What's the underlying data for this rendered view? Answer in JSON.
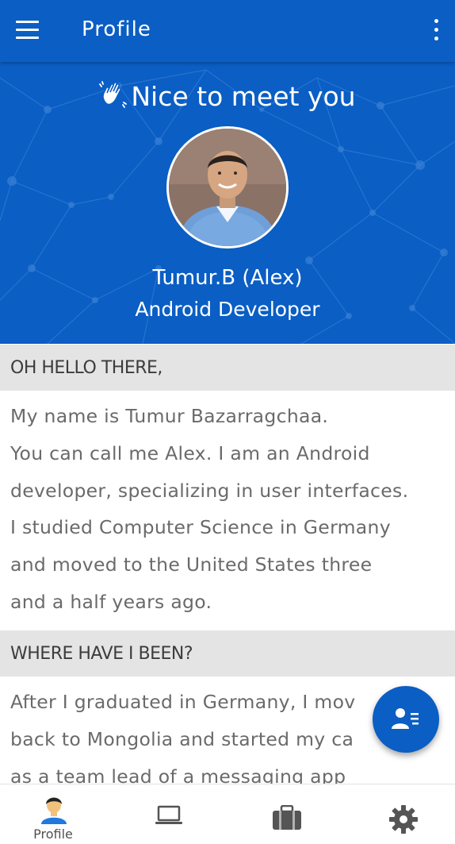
{
  "appbar": {
    "title": "Profile",
    "menu_icon": "hamburger-menu-icon",
    "overflow_icon": "more-vert-icon",
    "color": "#0a5ec4"
  },
  "hero": {
    "greeting": "Nice to meet you",
    "greeting_icon": "waving-hand-icon",
    "name": "Tumur.B (Alex)",
    "role": "Android Developer"
  },
  "sections": [
    {
      "heading": "OH HELLO THERE,",
      "lines": [
        "My name is Tumur Bazarragchaa.",
        "You can call me Alex. I am an Android",
        "developer, specializing in user interfaces.",
        "I studied Computer Science in Germany",
        "and moved to the United States three",
        "and a half years ago."
      ]
    },
    {
      "heading": "WHERE HAVE I BEEN?",
      "lines": [
        "After I graduated in Germany, I mov",
        "back to Mongolia and started my ca",
        "as a team lead of a messaging app"
      ]
    }
  ],
  "fab": {
    "icon": "contact-details-icon"
  },
  "bottom_nav": [
    {
      "label": "Profile",
      "icon": "profile-person-icon",
      "active": true
    },
    {
      "label": "",
      "icon": "laptop-icon",
      "active": false
    },
    {
      "label": "",
      "icon": "briefcase-icon",
      "active": false
    },
    {
      "label": "",
      "icon": "settings-gear-icon",
      "active": false
    }
  ]
}
